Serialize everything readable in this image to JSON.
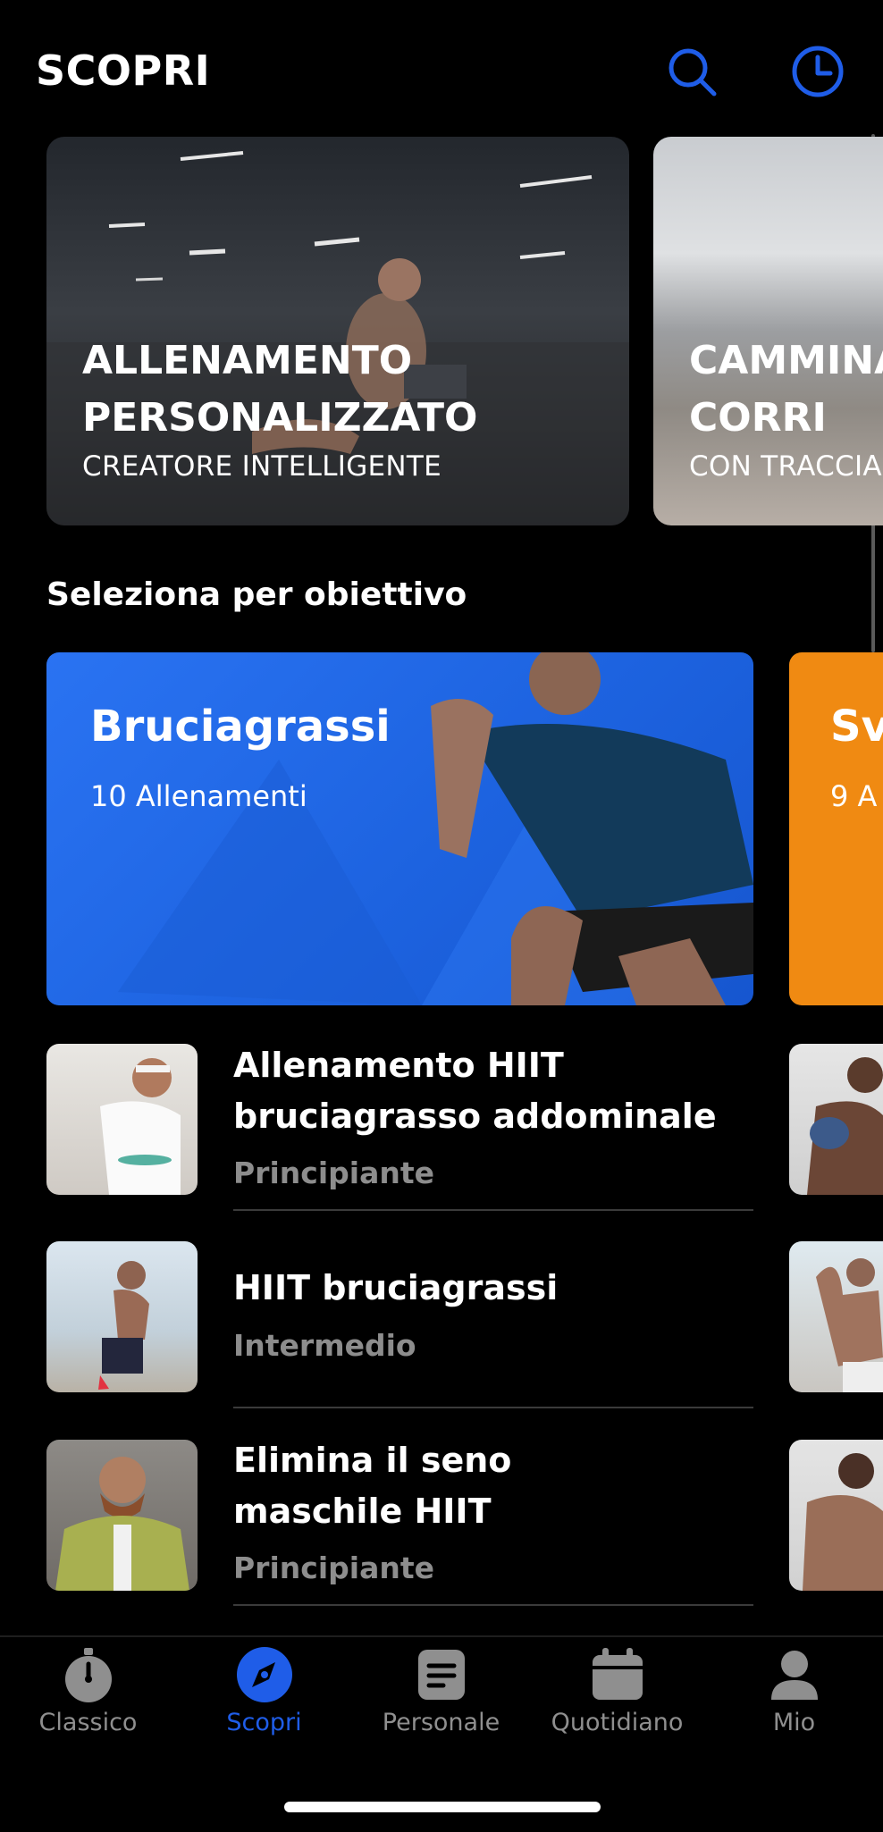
{
  "header": {
    "title": "SCOPRI",
    "icons": [
      "search-icon",
      "history-clock-icon"
    ],
    "accent_color": "#1f5de8"
  },
  "featured": [
    {
      "title_line1": "ALLENAMENTO",
      "title_line2": "PERSONALIZZATO",
      "subtitle": "CREATORE INTELLIGENTE"
    },
    {
      "title_line1": "CAMMINA",
      "title_line2": "CORRI",
      "subtitle": "CON TRACCIA"
    }
  ],
  "section": {
    "title": "Seleziona per obiettivo"
  },
  "goals": [
    {
      "title": "Bruciagrassi",
      "count": "10 Allenamenti",
      "color": "#1e6de8"
    },
    {
      "title": "Sv",
      "count": "9 A",
      "color": "#f08a12"
    }
  ],
  "workouts": [
    {
      "title_line1": "Allenamento HIIT",
      "title_line2": "bruciagrasso addominale",
      "level": "Principiante"
    },
    {
      "title_line1": "HIIT bruciagrassi",
      "title_line2": "",
      "level": "Intermedio"
    },
    {
      "title_line1": "Elimina il seno",
      "title_line2": "maschile HIIT",
      "level": "Principiante"
    }
  ],
  "nav": {
    "items": [
      {
        "label": "Classico",
        "icon": "stopwatch-icon",
        "active": false
      },
      {
        "label": "Scopri",
        "icon": "compass-icon",
        "active": true
      },
      {
        "label": "Personale",
        "icon": "document-icon",
        "active": false
      },
      {
        "label": "Quotidiano",
        "icon": "calendar-icon",
        "active": false
      },
      {
        "label": "Mio",
        "icon": "profile-icon",
        "active": false
      }
    ]
  }
}
